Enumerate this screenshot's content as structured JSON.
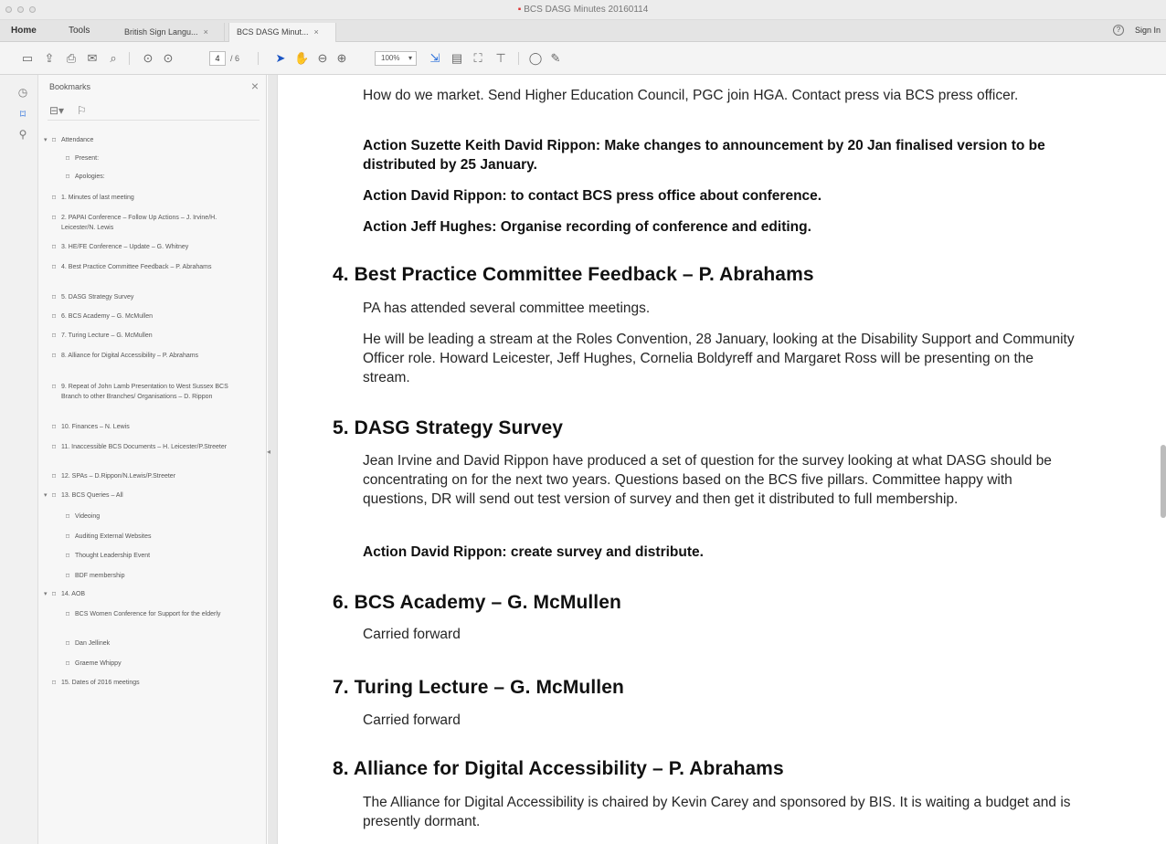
{
  "window": {
    "title": "BCS DASG Minutes 20160114"
  },
  "nav": {
    "home": "Home",
    "tools": "Tools"
  },
  "tabs": [
    {
      "label": "British Sign Langu...",
      "close": "×"
    },
    {
      "label": "BCS DASG Minut...",
      "close": "×"
    }
  ],
  "header": {
    "sign_in": "Sign In"
  },
  "toolbar": {
    "page_current": "4",
    "page_total": "/ 6",
    "zoom": "100%"
  },
  "bookmarks": {
    "title": "Bookmarks",
    "items": [
      "Attendance",
      "Present:",
      "Apologies:",
      "1. Minutes of last meeting",
      "2. PAPAI Conference – Follow Up Actions – J. Irvine/H. Leicester/N. Lewis",
      "3. HE/FE Conference – Update – G. Whitney",
      "4. Best Practice Committee Feedback – P. Abrahams",
      "5. DASG Strategy Survey",
      "6. BCS Academy – G. McMullen",
      "7. Turing Lecture – G. McMullen",
      "8. Alliance for Digital Accessibility – P. Abrahams",
      "9. Repeat of John Lamb Presentation to West Sussex BCS Branch to other Branches/ Organisations – D. Rippon",
      "10. Finances – N. Lewis",
      "11. Inaccessible BCS Documents – H. Leicester/P.Streeter",
      "12. SPAs – D.Rippon/N.Lewis/P.Streeter",
      "13. BCS Queries – All",
      "Videoing",
      "Auditing External Websites",
      "Thought Leadership Event",
      "BDF membership",
      "14. AOB",
      "BCS Women Conference for Support for the elderly",
      "Dan Jellinek",
      "Graeme Whippy",
      "15. Dates of 2016 meetings"
    ]
  },
  "document": {
    "p1": "How do we market. Send Higher Education Council, PGC join HGA. Contact press via BCS press officer.",
    "a1": "Action Suzette Keith David Rippon: Make changes to announcement by 20 Jan finalised version to be distributed by 25 January.",
    "a2": "Action David Rippon: to contact BCS press office about conference.",
    "a3": "Action Jeff Hughes: Organise recording of conference and editing.",
    "h4": "4. Best Practice Committee Feedback – P. Abrahams",
    "p4a": "PA has attended several committee meetings.",
    "p4b": "He will be leading a stream at the Roles Convention, 28 January, looking at the Disability Support and Community Officer role. Howard Leicester, Jeff Hughes, Cornelia Boldyreff and Margaret Ross will be presenting on the stream.",
    "h5": "5. DASG Strategy Survey",
    "p5": "Jean Irvine and David Rippon have produced a set of question for the survey looking at what DASG should be concentrating on for the next two years. Questions based on the BCS five pillars. Committee happy with questions, DR will send out test version of survey and then get it distributed to full membership.",
    "a5": "Action David Rippon: create survey and distribute.",
    "h6": "6. BCS Academy – G. McMullen",
    "p6": "Carried forward",
    "h7": "7. Turing Lecture – G. McMullen",
    "p7": "Carried forward",
    "h8": "8. Alliance for Digital Accessibility – P. Abrahams",
    "p8": "The Alliance for Digital Accessibility is chaired by Kevin Carey and sponsored by BIS.  It is waiting a budget and is presently dormant."
  }
}
